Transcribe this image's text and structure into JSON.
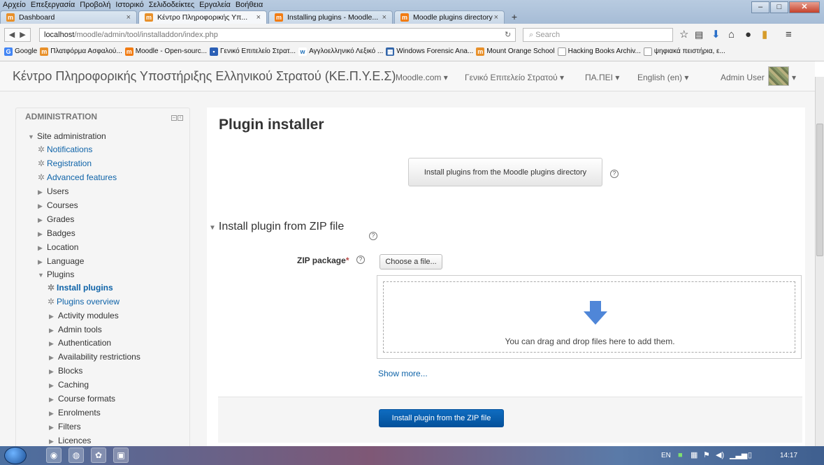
{
  "browser": {
    "menu": [
      "Αρχείο",
      "Επεξεργασία",
      "Προβολή",
      "Ιστορικό",
      "Σελιδοδείκτες",
      "Εργαλεία",
      "Βοήθεια"
    ],
    "tabs": [
      {
        "label": "Dashboard",
        "icon": "moodle-hat-icon",
        "active": false
      },
      {
        "label": "Κέντρο Πληροφορικής Υπ...",
        "icon": "moodle-hat-icon",
        "active": true
      },
      {
        "label": "Installing plugins - Moodle...",
        "icon": "moodle-m-icon",
        "active": false
      },
      {
        "label": "Moodle plugins directory",
        "icon": "moodle-m-icon",
        "active": false
      }
    ],
    "url_host": "localhost",
    "url_path": "/moodle/admin/tool/installaddon/index.php",
    "search_placeholder": "Search",
    "bookmarks": [
      "Google",
      "Πλατφόρμα Ασφαλού...",
      "Moodle - Open-sourc...",
      "Γενικό Επιτελείο Στρατ...",
      "Αγγλοελληνικό Λεξικό ...",
      "Windows Forensic Ana...",
      "Mount Orange School",
      "Hacking Books Archiv...",
      "ψηφιακά πειστήρια, ε..."
    ]
  },
  "site": {
    "name": "Κέντρο Πληροφορικής Υποστήριξης Ελληνικού Στρατού (ΚΕ.Π.Υ.Ε.Σ)",
    "menu": [
      "Moodle.com",
      "Γενικό Επιτελείο Στρατού",
      "ΠΑ.ΠΕΙ",
      "English (en)"
    ],
    "user": "Admin User"
  },
  "sidebar": {
    "title": "ADMINISTRATION",
    "root": "Site administration",
    "gear_items": [
      "Notifications",
      "Registration",
      "Advanced features"
    ],
    "sections": [
      "Users",
      "Courses",
      "Grades",
      "Badges",
      "Location",
      "Language"
    ],
    "plugins": "Plugins",
    "plugin_links": [
      "Install plugins",
      "Plugins overview"
    ],
    "plugin_sections": [
      "Activity modules",
      "Admin tools",
      "Authentication",
      "Availability restrictions",
      "Blocks",
      "Caching",
      "Course formats",
      "Enrolments",
      "Filters",
      "Licences"
    ]
  },
  "main": {
    "title": "Plugin installer",
    "directory_button": "Install plugins from the Moodle plugins directory",
    "zip_section_title": "Install plugin from ZIP file",
    "zip_label": "ZIP package",
    "required_mark": "*",
    "choose_file": "Choose a file...",
    "drop_text": "You can drag and drop files here to add them.",
    "show_more": "Show more...",
    "install_zip_button": "Install plugin from the ZIP file"
  },
  "taskbar": {
    "lang": "EN",
    "time": "14:17"
  },
  "colors": {
    "link": "#0e63a8",
    "primary_button": "#0f6cc0",
    "drop_arrow": "#4f86d8",
    "required": "#b94a48"
  }
}
